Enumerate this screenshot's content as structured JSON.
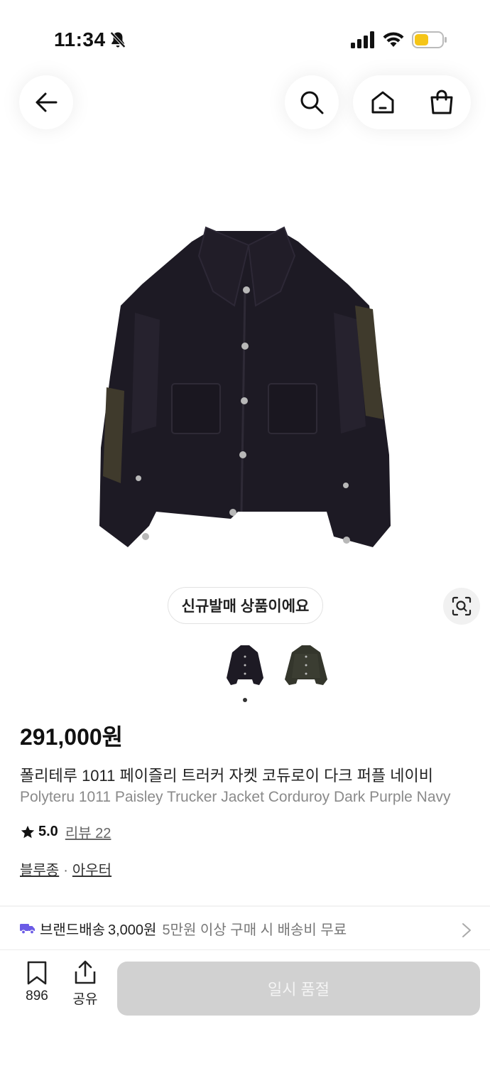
{
  "status_bar": {
    "time": "11:34",
    "battery_color": "#f5c518"
  },
  "product": {
    "badge": "신규발매 상품이에요",
    "price": "291,000원",
    "name_ko": "폴리테루 1011 페이즐리 트러커 자켓 코듀로이 다크 퍼플 네이비",
    "name_en": "Polyteru 1011 Paisley Trucker Jacket Corduroy Dark Purple Navy",
    "rating": "5.0",
    "review_label": "리뷰 22",
    "categories": [
      "블루종",
      "아우터"
    ],
    "category_sep": "·"
  },
  "shipping": {
    "label": "브랜드배송",
    "price": "3,000원",
    "condition": "5만원 이상 구매 시 배송비 무료",
    "icon_color": "#6b5be6"
  },
  "bottom_bar": {
    "save_count": "896",
    "share_label": "공유",
    "buy_button": "일시 품절"
  },
  "icons": [
    "back-arrow-icon",
    "search-icon",
    "home-icon",
    "shopping-bag-icon",
    "visual-search-icon",
    "bookmark-icon",
    "share-icon",
    "star-icon",
    "truck-icon",
    "chevron-right-icon"
  ]
}
